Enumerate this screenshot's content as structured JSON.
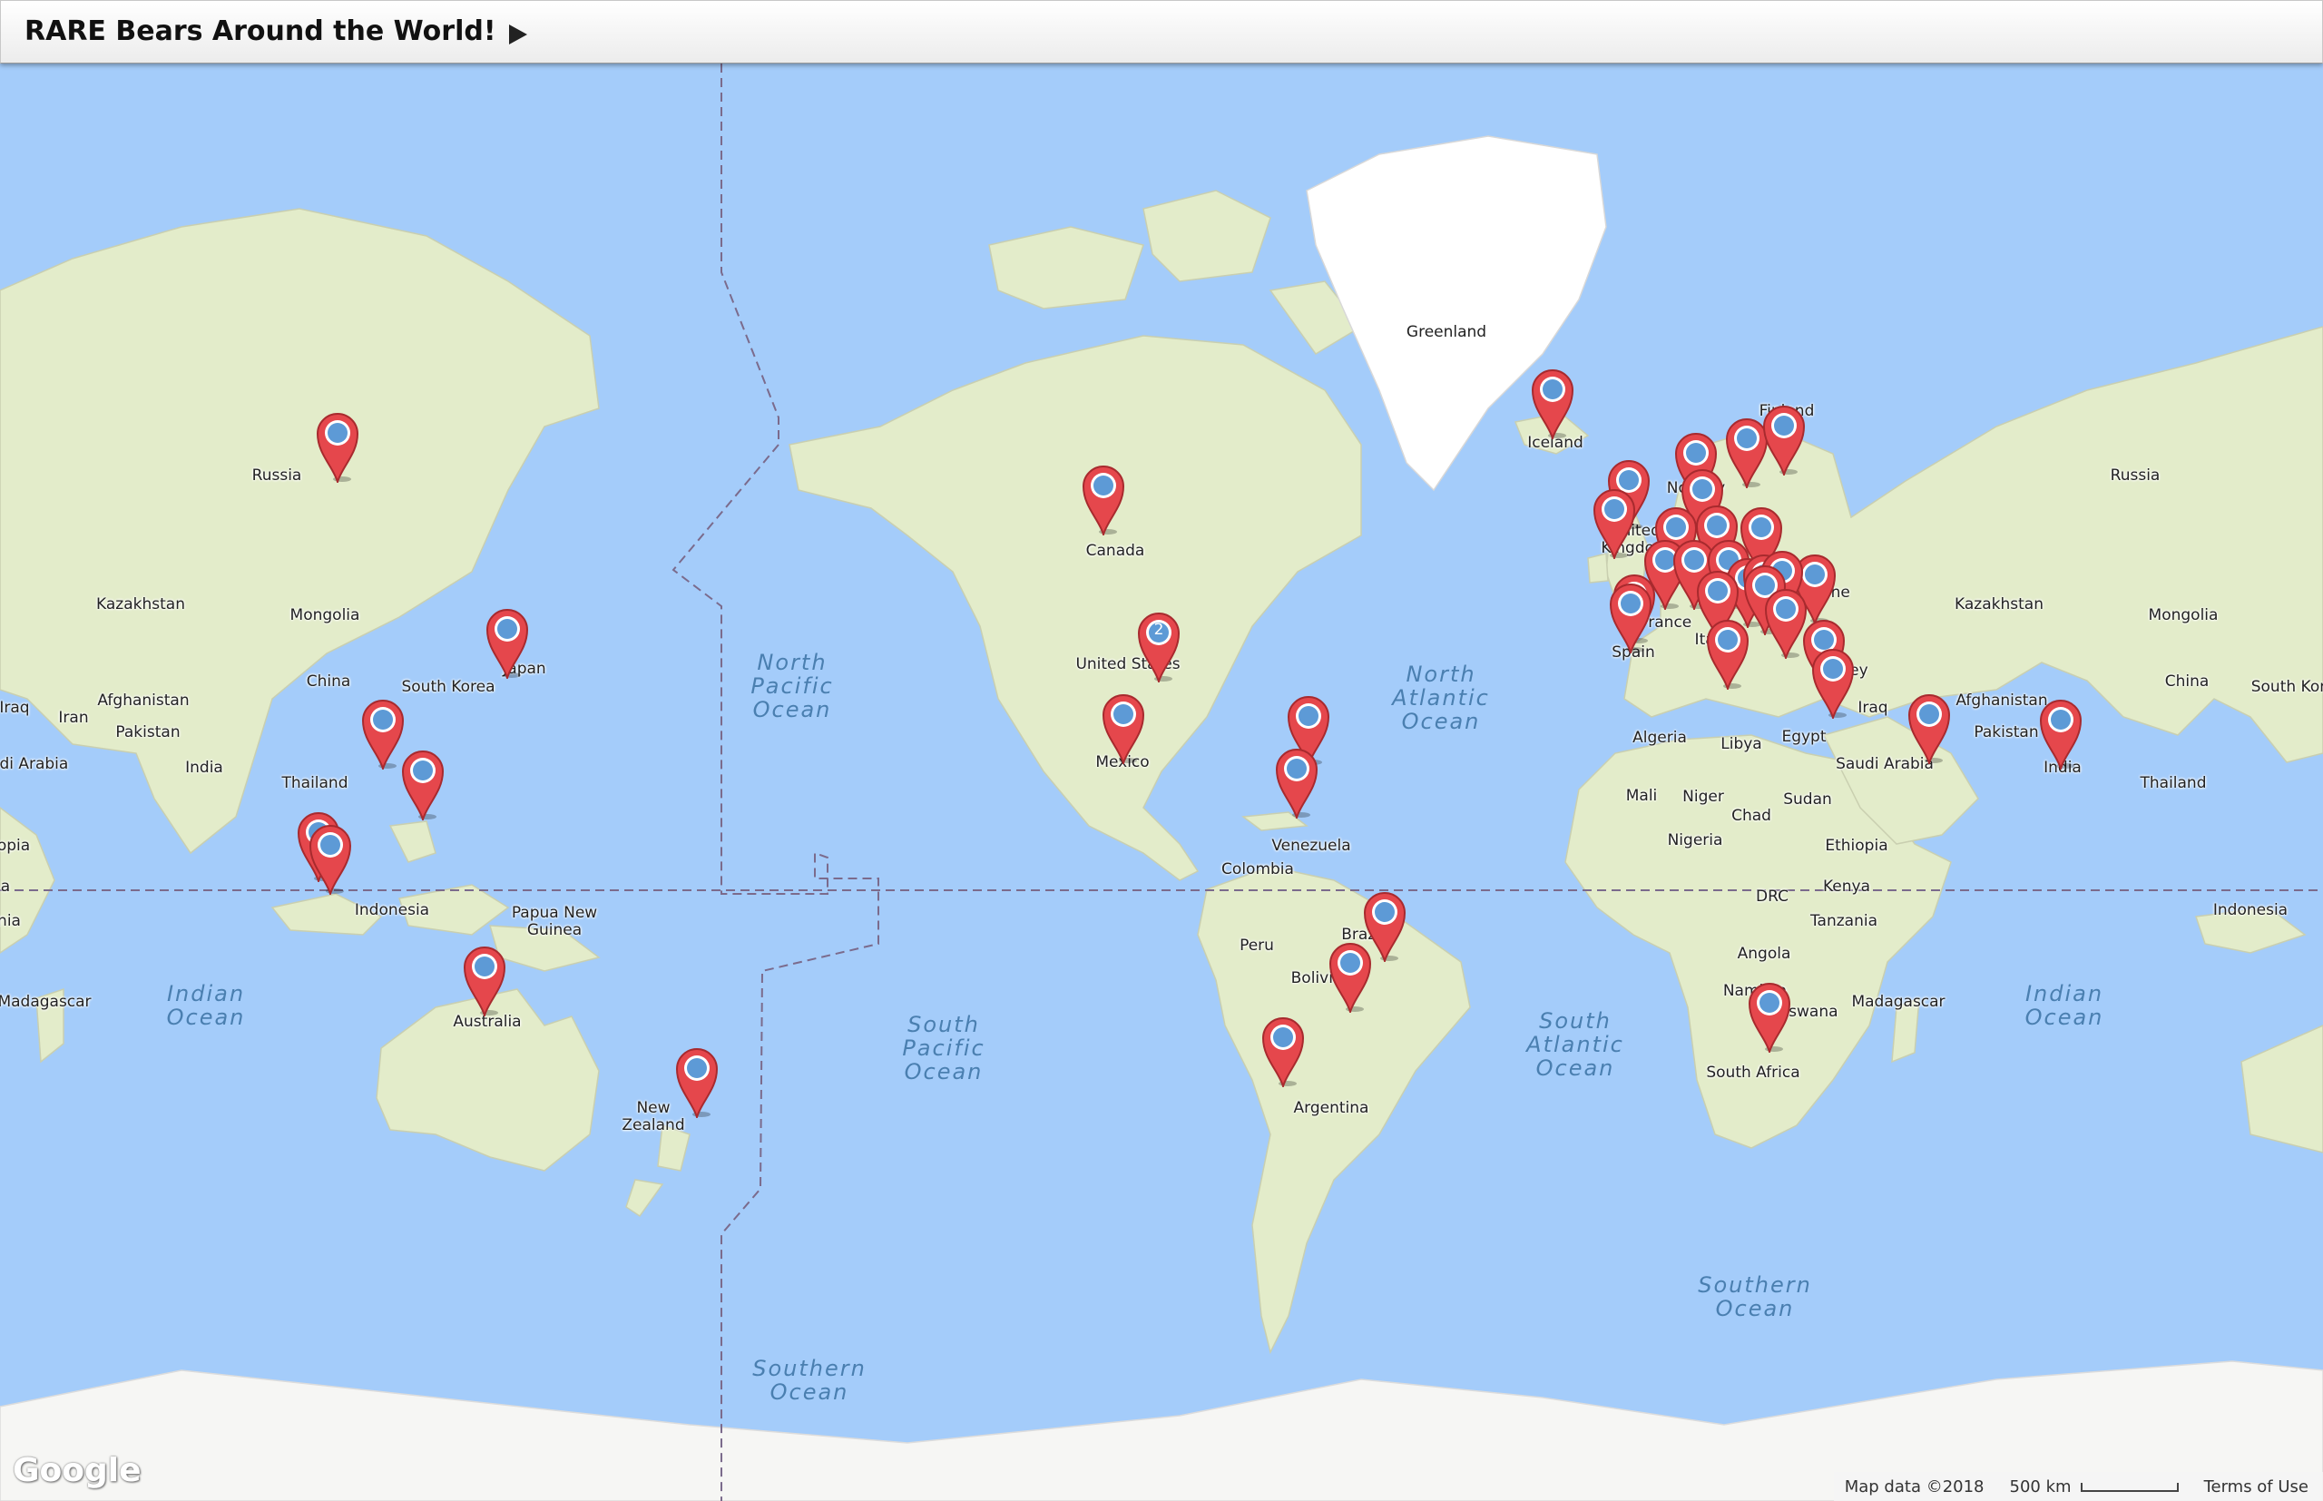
{
  "header": {
    "title": "RARE Bears Around the World!",
    "menu_icon": "play-arrow-icon"
  },
  "map": {
    "ocean_color": "#a4ccfa",
    "land_color": "#e3ecca",
    "ice_color": "#ffffff",
    "countries": {
      "russia_w": "Russia",
      "russia_e": "Russia",
      "kazakhstan_w": "Kazakhstan",
      "kazakhstan_e": "Kazakhstan",
      "mongolia_w": "Mongolia",
      "mongolia_e": "Mongolia",
      "china_w": "China",
      "china_e": "China",
      "south_korea_w": "South Korea",
      "south_korea_e": "South Kor",
      "japan": "Japan",
      "afghanistan_w": "Afghanistan",
      "afghanistan_e": "Afghanistan",
      "iraq_w": "Iraq",
      "iraq_e": "Iraq",
      "iran": "Iran",
      "pakistan_w": "Pakistan",
      "pakistan_e": "Pakistan",
      "saudi_arabia_w": "udi Arabia",
      "saudi_arabia_e": "Saudi Arabia",
      "india_w": "India",
      "india_e": "India",
      "thailand_w": "Thailand",
      "thailand_e": "Thailand",
      "ethiopia_w": "opia",
      "ethiopia_e": "Ethiopia",
      "kenya_w": "a",
      "kenya_e": "Kenya",
      "indonesia_w": "Indonesia",
      "indonesia_e": "Indonesia",
      "tanzania_w": "nia",
      "tanzania_e": "Tanzania",
      "papua_new_guinea": "Papua New\nGuinea",
      "madagascar_w": "Madagascar",
      "madagascar_e": "Madagascar",
      "australia": "Australia",
      "new_zealand": "New\nZealand",
      "canada": "Canada",
      "united_states": "United States",
      "mexico": "Mexico",
      "venezuela": "Venezuela",
      "colombia": "Colombia",
      "peru": "Peru",
      "brazil": "Brazil",
      "bolivia": "Bolivia",
      "argentina": "Argentina",
      "greenland": "Greenland",
      "iceland": "Iceland",
      "finland": "Finland",
      "norway": "Norway",
      "united_kingdom": "United\nKingdom",
      "france": "France",
      "spain": "Spain",
      "italy": "Italy",
      "ukraine": "Ukraine",
      "turkey": "Turkey",
      "algeria": "Algeria",
      "libya": "Libya",
      "egypt": "Egypt",
      "mali": "Mali",
      "niger": "Niger",
      "chad": "Chad",
      "sudan": "Sudan",
      "nigeria": "Nigeria",
      "drc": "DRC",
      "angola": "Angola",
      "namibia": "Namibia",
      "botswana": "Botswana",
      "south_africa": "South Africa"
    },
    "oceans": {
      "north_pacific": "North\nPacific\nOcean",
      "north_atlantic": "North\nAtlantic\nOcean",
      "indian_w": "Indian\nOcean",
      "indian_e": "Indian\nOcean",
      "south_pacific": "South\nPacific\nOcean",
      "south_atlantic": "South\nAtlantic\nOcean",
      "southern_w": "Southern\nOcean",
      "southern_e": "Southern\nOcean"
    },
    "markers": [
      {
        "location": "Russia"
      },
      {
        "location": "Japan"
      },
      {
        "location": "China"
      },
      {
        "location": "Philippines"
      },
      {
        "location": "Thailand"
      },
      {
        "location": "Singapore"
      },
      {
        "location": "Australia"
      },
      {
        "location": "New Zealand"
      },
      {
        "location": "Canada"
      },
      {
        "location": "United States",
        "count": "2"
      },
      {
        "location": "Mexico"
      },
      {
        "location": "Puerto Rico"
      },
      {
        "location": "Dominican Republic"
      },
      {
        "location": "Brazil"
      },
      {
        "location": "Bolivia"
      },
      {
        "location": "Chile"
      },
      {
        "location": "Iceland"
      },
      {
        "location": "Norway"
      },
      {
        "location": "Sweden"
      },
      {
        "location": "Finland"
      },
      {
        "location": "United Kingdom"
      },
      {
        "location": "Ireland"
      },
      {
        "location": "Denmark"
      },
      {
        "location": "Netherlands"
      },
      {
        "location": "Germany"
      },
      {
        "location": "Poland"
      },
      {
        "location": "Belgium"
      },
      {
        "location": "France"
      },
      {
        "location": "Switzerland"
      },
      {
        "location": "Czechia"
      },
      {
        "location": "Austria"
      },
      {
        "location": "Hungary"
      },
      {
        "location": "Ukraine"
      },
      {
        "location": "Romania"
      },
      {
        "location": "Serbia"
      },
      {
        "location": "Croatia"
      },
      {
        "location": "Spain"
      },
      {
        "location": "Italy"
      },
      {
        "location": "Bulgaria"
      },
      {
        "location": "Turkey"
      },
      {
        "location": "Cyprus"
      },
      {
        "location": "Oman"
      },
      {
        "location": "India"
      },
      {
        "location": "South Africa"
      }
    ]
  },
  "footer": {
    "logo": "Google",
    "attribution": "Map data ©2018",
    "scale_label": "500 km",
    "terms": "Terms of Use"
  }
}
